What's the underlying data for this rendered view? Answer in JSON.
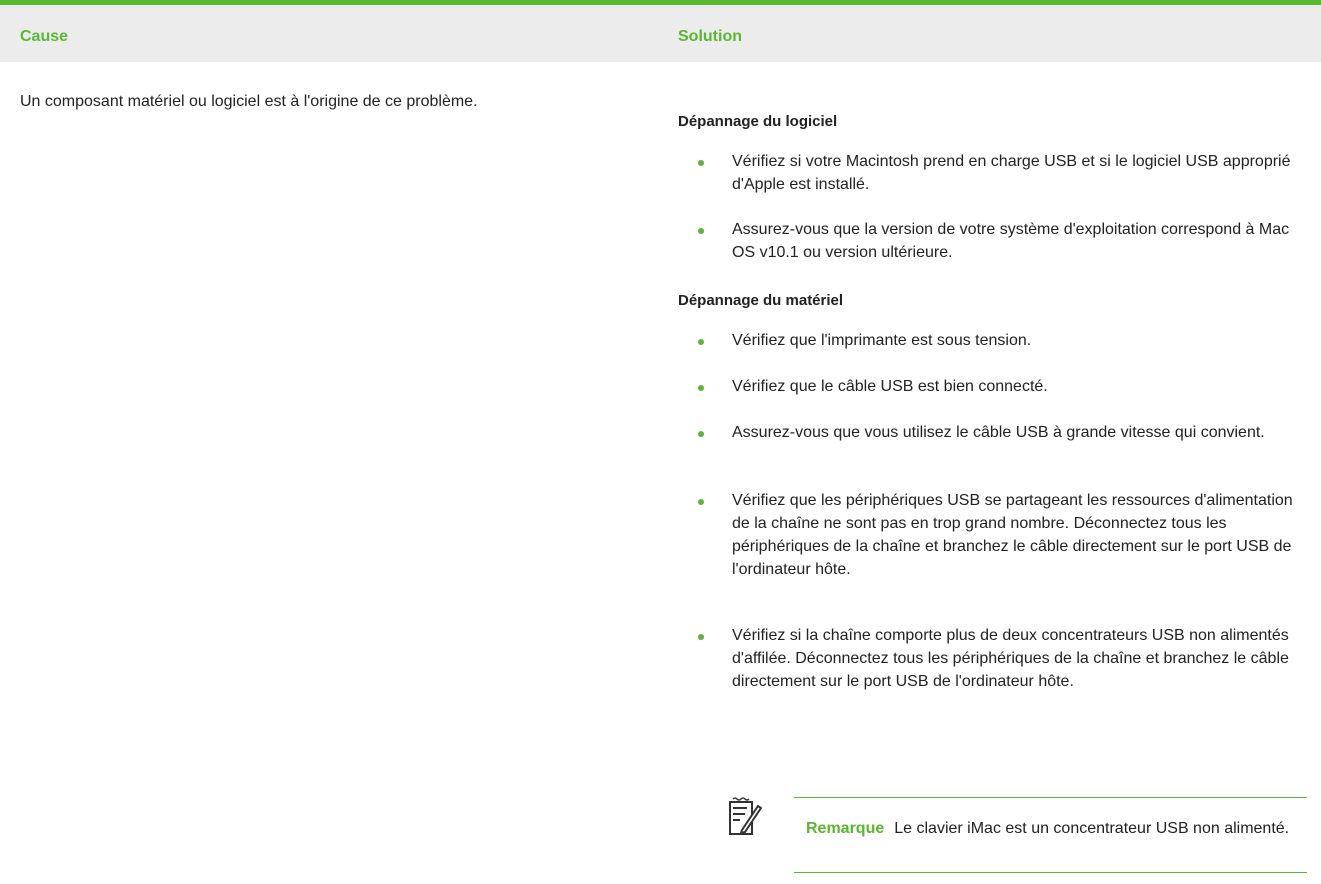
{
  "table": {
    "header_cause": "Cause",
    "header_solution": "Solution",
    "cause": "Un composant matériel ou logiciel est à l'origine de ce problème.",
    "software_title": "Dépannage du logiciel",
    "software_items": [
      "Vérifiez si votre Macintosh prend en charge USB et si le logiciel USB approprié d'Apple est installé.",
      "Assurez-vous que la version de votre système d'exploitation correspond à Mac OS v10.1 ou version ultérieure."
    ],
    "hardware_title": "Dépannage du matériel",
    "hardware_items": [
      "Vérifiez que l'imprimante est sous tension.",
      "Vérifiez que le câble USB est bien connecté.",
      "Assurez-vous que vous utilisez le câble USB à grande vitesse qui convient.",
      "Vérifiez que les périphériques USB se partageant les ressources d'alimentation de la chaîne ne sont pas en trop grand nombre. Déconnectez tous les périphériques de la chaîne et branchez le câble directement sur le port USB de l'ordinateur hôte.",
      "Vérifiez si la chaîne comporte plus de deux concentrateurs USB non alimentés d'affilée. Déconnectez tous les périphériques de la chaîne et branchez le câble directement sur le port USB de l'ordinateur hôte."
    ],
    "note_label": "Remarque",
    "note_text": "Le clavier iMac est un concentrateur USB non alimenté."
  },
  "colors": {
    "accent": "#5cb730",
    "header_bg": "#ececec",
    "text": "#222222"
  },
  "icons": {
    "note": "note-pencil-icon",
    "bullet": "green-dot-icon"
  }
}
